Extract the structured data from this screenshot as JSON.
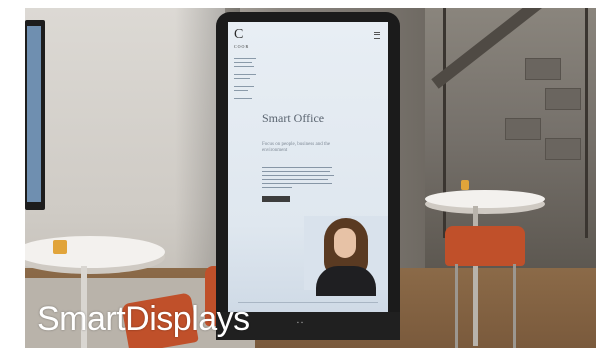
{
  "caption": "SmartDisplays",
  "screen": {
    "logo_letter": "C",
    "logo_word": "COOR",
    "title": "Smart Office",
    "subtitle": "Focus on people, business and the environment"
  },
  "colors": {
    "kiosk_frame": "#1b1b1b",
    "screen": "#e8eef4",
    "chair": "#c0502a",
    "caption_text": "#ffffff"
  }
}
